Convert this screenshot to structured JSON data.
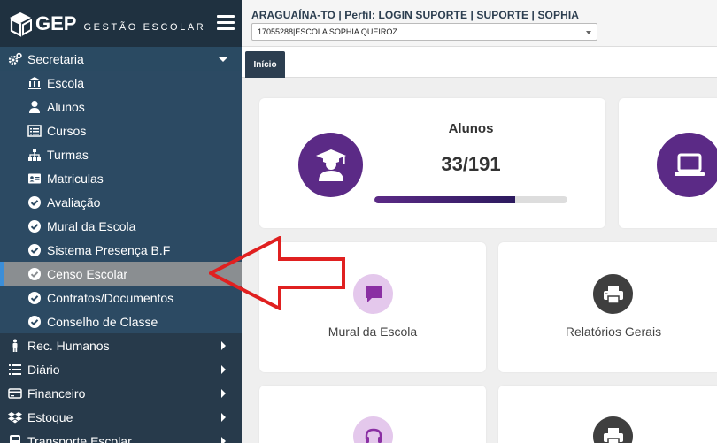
{
  "brand": {
    "name": "GEP",
    "subtitle": "GESTÃO ESCOLAR"
  },
  "header": {
    "title": "ARAGUAÍNA-TO | Perfil: LOGIN SUPORTE | SUPORTE | SOPHIA",
    "school_select": "17055288|ESCOLA SOPHIA QUEIROZ"
  },
  "tabs": [
    {
      "label": "Início"
    }
  ],
  "sidebar": {
    "section": "Secretaria",
    "sub_items": [
      {
        "label": "Escola",
        "icon": "bank-icon"
      },
      {
        "label": "Alunos",
        "icon": "user-icon"
      },
      {
        "label": "Cursos",
        "icon": "list-icon"
      },
      {
        "label": "Turmas",
        "icon": "sitemap-icon"
      },
      {
        "label": "Matriculas",
        "icon": "id-card-icon"
      },
      {
        "label": "Avaliação",
        "icon": "check-circle-icon"
      },
      {
        "label": "Mural da Escola",
        "icon": "check-circle-icon"
      },
      {
        "label": "Sistema Presença B.F",
        "icon": "check-circle-icon"
      },
      {
        "label": "Censo Escolar",
        "icon": "check-circle-icon"
      },
      {
        "label": "Contratos/Documentos",
        "icon": "check-circle-icon"
      },
      {
        "label": "Conselho de Classe",
        "icon": "check-circle-icon"
      }
    ],
    "top_items": [
      {
        "label": "Rec. Humanos",
        "icon": "person-icon"
      },
      {
        "label": "Diário",
        "icon": "list-ol-icon"
      },
      {
        "label": "Financeiro",
        "icon": "credit-card-icon"
      },
      {
        "label": "Estoque",
        "icon": "dropbox-icon"
      },
      {
        "label": "Transporte Escolar",
        "icon": "bus-icon"
      }
    ]
  },
  "cards": {
    "alunos": {
      "title": "Alunos",
      "value": "33/191",
      "progress": 0.73
    },
    "mural": {
      "label": "Mural da Escola"
    },
    "relatorios": {
      "label": "Relatórios Gerais"
    }
  },
  "colors": {
    "sidebar": "#2c3e50",
    "active_item": "#8a8e91",
    "purple": "#5b2a86",
    "light_purple": "#e4c8ec",
    "gray_circle": "#3f3f3f",
    "arrow": "#e02020"
  }
}
